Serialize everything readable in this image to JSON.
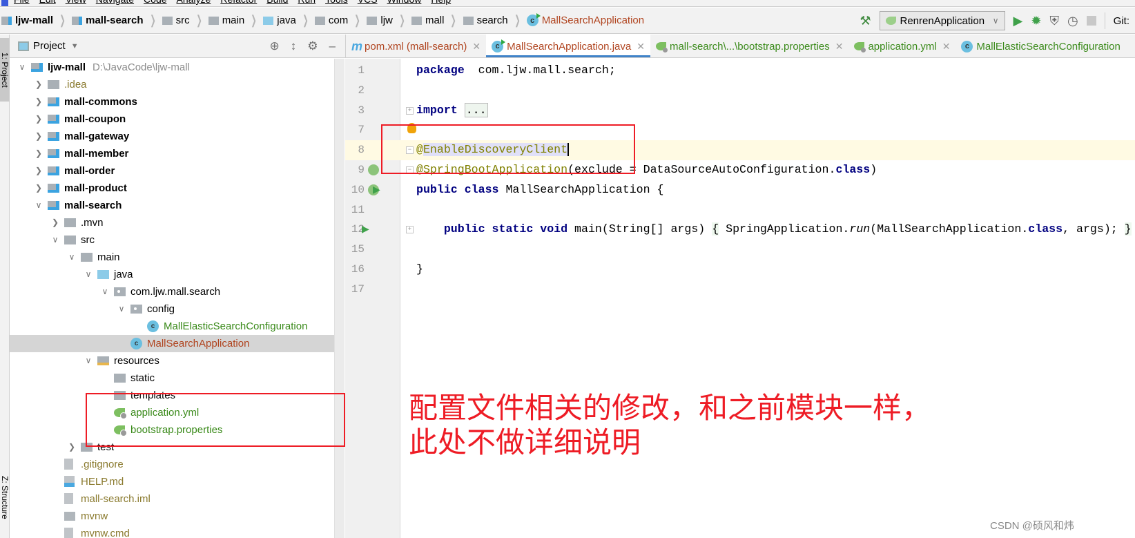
{
  "menu": [
    "File",
    "Edit",
    "View",
    "Navigate",
    "Code",
    "Analyze",
    "Refactor",
    "Build",
    "Run",
    "Tools",
    "VCS",
    "Window",
    "Help"
  ],
  "breadcrumb": [
    {
      "label": "ljw-mall",
      "icon": "module-folder-icon",
      "bold": true
    },
    {
      "label": "mall-search",
      "icon": "module-folder-icon",
      "bold": true
    },
    {
      "label": "src",
      "icon": "folder-icon"
    },
    {
      "label": "main",
      "icon": "folder-icon"
    },
    {
      "label": "java",
      "icon": "source-folder-icon"
    },
    {
      "label": "com",
      "icon": "package-icon"
    },
    {
      "label": "ljw",
      "icon": "package-icon"
    },
    {
      "label": "mall",
      "icon": "package-icon"
    },
    {
      "label": "search",
      "icon": "package-icon"
    },
    {
      "label": "MallSearchApplication",
      "icon": "spring-boot-class-icon",
      "current": true
    }
  ],
  "toolbar": {
    "run_config": "RenrenApplication",
    "git_label": "Git:"
  },
  "side_stripe": {
    "top": "1: Project",
    "bottom": "Z: Structure"
  },
  "project_panel": {
    "title": "Project",
    "tree": [
      {
        "label": "ljw-mall",
        "depth": 0,
        "chevron": "open",
        "icon": "module",
        "bold": true,
        "hint": "D:\\JavaCode\\ljw-mall"
      },
      {
        "label": ".idea",
        "depth": 1,
        "chevron": "closed",
        "icon": "folder",
        "color": "#8a7a2e"
      },
      {
        "label": "mall-commons",
        "depth": 1,
        "chevron": "closed",
        "icon": "module",
        "bold": true
      },
      {
        "label": "mall-coupon",
        "depth": 1,
        "chevron": "closed",
        "icon": "module",
        "bold": true
      },
      {
        "label": "mall-gateway",
        "depth": 1,
        "chevron": "closed",
        "icon": "module",
        "bold": true
      },
      {
        "label": "mall-member",
        "depth": 1,
        "chevron": "closed",
        "icon": "module",
        "bold": true
      },
      {
        "label": "mall-order",
        "depth": 1,
        "chevron": "closed",
        "icon": "module",
        "bold": true
      },
      {
        "label": "mall-product",
        "depth": 1,
        "chevron": "closed",
        "icon": "module",
        "bold": true
      },
      {
        "label": "mall-search",
        "depth": 1,
        "chevron": "open",
        "icon": "module",
        "bold": true
      },
      {
        "label": ".mvn",
        "depth": 2,
        "chevron": "closed",
        "icon": "folder"
      },
      {
        "label": "src",
        "depth": 2,
        "chevron": "open",
        "icon": "folder"
      },
      {
        "label": "main",
        "depth": 3,
        "chevron": "open",
        "icon": "folder"
      },
      {
        "label": "java",
        "depth": 4,
        "chevron": "open",
        "icon": "source"
      },
      {
        "label": "com.ljw.mall.search",
        "depth": 5,
        "chevron": "open",
        "icon": "package"
      },
      {
        "label": "config",
        "depth": 6,
        "chevron": "open",
        "icon": "package"
      },
      {
        "label": "MallElasticSearchConfiguration",
        "depth": 7,
        "icon": "class",
        "color": "#3a8a1a"
      },
      {
        "label": "MallSearchApplication",
        "depth": 6,
        "icon": "class",
        "color": "#b0441f",
        "selected": true
      },
      {
        "label": "resources",
        "depth": 4,
        "chevron": "open",
        "icon": "resources"
      },
      {
        "label": "static",
        "depth": 5,
        "icon": "folder"
      },
      {
        "label": "templates",
        "depth": 5,
        "icon": "folder"
      },
      {
        "label": "application.yml",
        "depth": 5,
        "icon": "spring",
        "color": "#3a8a1a"
      },
      {
        "label": "bootstrap.properties",
        "depth": 5,
        "icon": "spring",
        "color": "#3a8a1a"
      },
      {
        "label": "test",
        "depth": 3,
        "chevron": "closed",
        "icon": "folder"
      },
      {
        "label": ".gitignore",
        "depth": 2,
        "icon": "file",
        "color": "#8a7a2e"
      },
      {
        "label": "HELP.md",
        "depth": 2,
        "icon": "md",
        "color": "#8a7a2e"
      },
      {
        "label": "mall-search.iml",
        "depth": 2,
        "icon": "file",
        "color": "#8a7a2e"
      },
      {
        "label": "mvnw",
        "depth": 2,
        "icon": "exec",
        "color": "#8a7a2e"
      },
      {
        "label": "mvnw.cmd",
        "depth": 2,
        "icon": "file",
        "color": "#8a7a2e"
      }
    ]
  },
  "editor_tabs": [
    {
      "label": "pom.xml (mall-search)",
      "icon": "maven-icon",
      "color": "#b0441f"
    },
    {
      "label": "MallSearchApplication.java",
      "icon": "spring-boot-class-icon",
      "color": "#b0441f",
      "active": true
    },
    {
      "label": "mall-search\\...\\bootstrap.properties",
      "icon": "spring-config-icon",
      "color": "#3a8a1a"
    },
    {
      "label": "application.yml",
      "icon": "spring-config-icon",
      "color": "#3a8a1a"
    },
    {
      "label": "MallElasticSearchConfiguration",
      "icon": "class-icon",
      "color": "#3a8a1a"
    }
  ],
  "code": [
    {
      "n": "1",
      "tokens": [
        [
          "kw",
          "package"
        ],
        [
          "",
          "  com.ljw.mall.search;"
        ]
      ]
    },
    {
      "n": "2",
      "tokens": []
    },
    {
      "n": "3",
      "fold": "+",
      "tokens": [
        [
          "kw",
          "import"
        ],
        [
          "",
          " "
        ],
        [
          "fold",
          "..."
        ]
      ]
    },
    {
      "n": "7",
      "tokens": []
    },
    {
      "n": "8",
      "current": true,
      "fold": "-",
      "tokens": [
        [
          "ann",
          "@"
        ],
        [
          "ann sel",
          "EnableDiscoveryClient"
        ],
        [
          "caret",
          ""
        ]
      ]
    },
    {
      "n": "9",
      "fold": "-",
      "gicons": [
        "spring-bean-icon"
      ],
      "tokens": [
        [
          "ann",
          "@SpringBootApplication"
        ],
        [
          "",
          "(exclude = DataSourceAutoConfiguration."
        ],
        [
          "kw",
          "class"
        ],
        [
          "",
          ")"
        ]
      ]
    },
    {
      "n": "10",
      "gicons": [
        "spring-bean-icon",
        "run-icon"
      ],
      "tokens": [
        [
          "kw",
          "public class"
        ],
        [
          "",
          " MallSearchApplication {"
        ]
      ]
    },
    {
      "n": "11",
      "tokens": []
    },
    {
      "n": "12",
      "fold": "+",
      "gicons": [
        "run-icon"
      ],
      "tokens": [
        [
          "",
          "    "
        ],
        [
          "kw",
          "public static void"
        ],
        [
          "",
          " main(String[] args) "
        ],
        [
          "brace",
          "{"
        ],
        [
          "",
          " SpringApplication."
        ],
        [
          "it",
          "run"
        ],
        [
          "",
          "(MallSearchApplication."
        ],
        [
          "kw",
          "class"
        ],
        [
          "",
          ", args); "
        ],
        [
          "brace",
          "}"
        ]
      ]
    },
    {
      "n": "15",
      "tokens": []
    },
    {
      "n": "16",
      "tokens": [
        [
          "",
          "}"
        ]
      ]
    },
    {
      "n": "17",
      "tokens": []
    }
  ],
  "annotation": {
    "line1": "配置文件相关的修改，和之前模块一样，",
    "line2": "此处不做详细说明",
    "color": "#ee1c25"
  },
  "watermark": "CSDN @硕风和炜"
}
